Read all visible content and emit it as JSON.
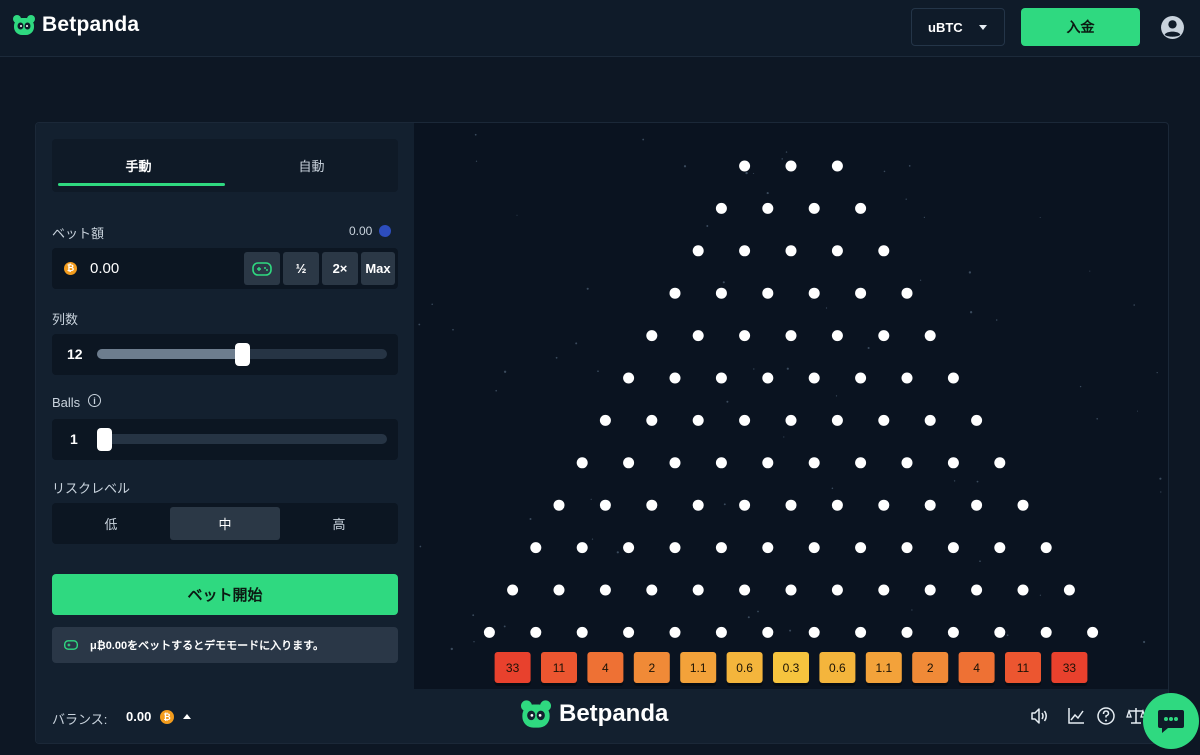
{
  "brand": {
    "name": "Betpanda",
    "accent": "#2fd980"
  },
  "header": {
    "currency": "uBTC",
    "deposit_label": "入金"
  },
  "tabs": [
    {
      "label": "手動"
    },
    {
      "label": "自動"
    }
  ],
  "bet": {
    "label": "ベット額",
    "converted": "0.00",
    "amount": "0.00",
    "buttons": [
      "½",
      "2×",
      "Max"
    ]
  },
  "rows": {
    "label": "列数",
    "value": "12",
    "fraction": 0.5
  },
  "balls": {
    "label": "Balls",
    "value": "1",
    "fraction": 0.0
  },
  "risk": {
    "label": "リスクレベル",
    "options": [
      "低",
      "中",
      "高"
    ],
    "selected": "中"
  },
  "start_label": "ベット開始",
  "notice": "μ₿0.00をベットするとデモモードに入ります。",
  "footer": {
    "balance_label": "バランス:",
    "balance_value": "0.00"
  },
  "multipliers": [
    "33",
    "11",
    "4",
    "2",
    "1.1",
    "0.6",
    "0.3",
    "0.6",
    "1.1",
    "2",
    "4",
    "11",
    "33"
  ],
  "multiplier_colors": [
    "#e8412d",
    "#ec5630",
    "#ee7134",
    "#f08a37",
    "#f3a23a",
    "#f4b53c",
    "#f6c43e",
    "#f4b53c",
    "#f3a23a",
    "#f08a37",
    "#ee7134",
    "#ec5630",
    "#e8412d"
  ]
}
